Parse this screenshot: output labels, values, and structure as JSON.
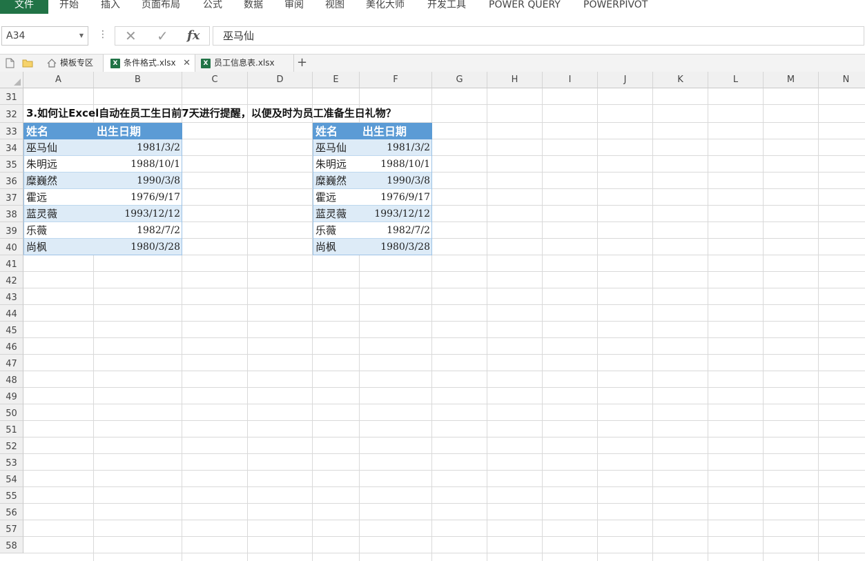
{
  "ribbon": {
    "tabs": [
      "文件",
      "开始",
      "插入",
      "页面布局",
      "公式",
      "数据",
      "审阅",
      "视图",
      "美化大师",
      "开发工具",
      "POWER QUERY",
      "POWERPIVOT"
    ]
  },
  "formula_bar": {
    "name_box": "A34",
    "fx_label": "fx",
    "value": "巫马仙"
  },
  "doc_tabs": [
    {
      "label": "模板专区",
      "icon": "home-icon",
      "active": false
    },
    {
      "label": "条件格式.xlsx",
      "icon": "excel-file-icon",
      "active": true
    },
    {
      "label": "员工信息表.xlsx",
      "icon": "excel-file-icon",
      "active": false
    }
  ],
  "grid": {
    "columns": [
      "A",
      "B",
      "C",
      "D",
      "E",
      "F",
      "G",
      "H",
      "I",
      "J",
      "K",
      "L",
      "M",
      "N"
    ],
    "rows": [
      "31",
      "32",
      "33",
      "34",
      "35",
      "36",
      "37",
      "38",
      "39",
      "40",
      "41",
      "42",
      "43",
      "44",
      "45",
      "46",
      "47",
      "48",
      "49",
      "50",
      "51",
      "52",
      "53",
      "54",
      "55",
      "56",
      "57",
      "58"
    ]
  },
  "sheet": {
    "title": "3.如何让Excel自动在员工生日前7天进行提醒，以便及时为员工准备生日礼物？",
    "table_left": {
      "headers": [
        "姓名",
        "出生日期"
      ],
      "rows": [
        {
          "name": "巫马仙",
          "date": "1981/3/2"
        },
        {
          "name": "朱明远",
          "date": "1988/10/1"
        },
        {
          "name": "糜巍然",
          "date": "1990/3/8"
        },
        {
          "name": "霍远",
          "date": "1976/9/17"
        },
        {
          "name": "蓝灵薇",
          "date": "1993/12/12"
        },
        {
          "name": "乐薇",
          "date": "1982/7/2"
        },
        {
          "name": "尚枫",
          "date": "1980/3/28"
        }
      ]
    },
    "table_right": {
      "headers": [
        "姓名",
        "出生日期"
      ],
      "rows": [
        {
          "name": "巫马仙",
          "date": "1981/3/2"
        },
        {
          "name": "朱明远",
          "date": "1988/10/1"
        },
        {
          "name": "糜巍然",
          "date": "1990/3/8"
        },
        {
          "name": "霍远",
          "date": "1976/9/17"
        },
        {
          "name": "蓝灵薇",
          "date": "1993/12/12"
        },
        {
          "name": "乐薇",
          "date": "1982/7/2"
        },
        {
          "name": "尚枫",
          "date": "1980/3/28"
        }
      ]
    }
  }
}
